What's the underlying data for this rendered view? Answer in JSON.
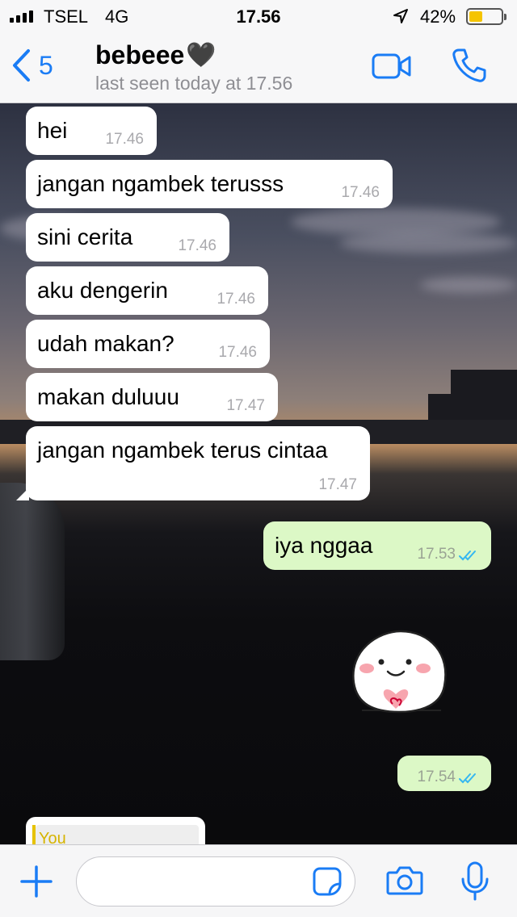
{
  "status_bar": {
    "carrier": "TSEL",
    "network": "4G",
    "time": "17.56",
    "battery_percent": "42%",
    "battery_level": 0.42
  },
  "header": {
    "back_count": "5",
    "contact_name": "bebeee",
    "contact_emoji": "🖤",
    "last_seen": "last seen today at 17.56",
    "icons": [
      "chevron-left-icon",
      "video-call-icon",
      "phone-icon"
    ]
  },
  "messages": [
    {
      "direction": "in",
      "text": "hei",
      "time": "17.46"
    },
    {
      "direction": "in",
      "text": "jangan ngambek terusss",
      "time": "17.46"
    },
    {
      "direction": "in",
      "text": "sini cerita",
      "time": "17.46"
    },
    {
      "direction": "in",
      "text": "aku dengerin",
      "time": "17.46"
    },
    {
      "direction": "in",
      "text": "udah makan?",
      "time": "17.46"
    },
    {
      "direction": "in",
      "text": "makan duluuu",
      "time": "17.47"
    },
    {
      "direction": "in",
      "text": "jangan ngambek terus cintaa",
      "time": "17.47"
    },
    {
      "direction": "out",
      "text": "iya nggaa",
      "time": "17.53",
      "status": "read"
    },
    {
      "direction": "out",
      "type": "sticker",
      "sticker": "white-mochi-holding-heart"
    },
    {
      "direction": "out",
      "text": "",
      "time": "17.54",
      "status": "read"
    }
  ],
  "reply_preview": {
    "label": "You"
  },
  "composer": {
    "placeholder": "",
    "value": "",
    "icons": [
      "plus-icon",
      "sticker-icon",
      "camera-icon",
      "microphone-icon"
    ]
  },
  "colors": {
    "accent": "#1a7cf5",
    "outgoing_bubble": "#dcf8c6",
    "incoming_bubble": "#ffffff",
    "read_ticks": "#34b7f1"
  }
}
